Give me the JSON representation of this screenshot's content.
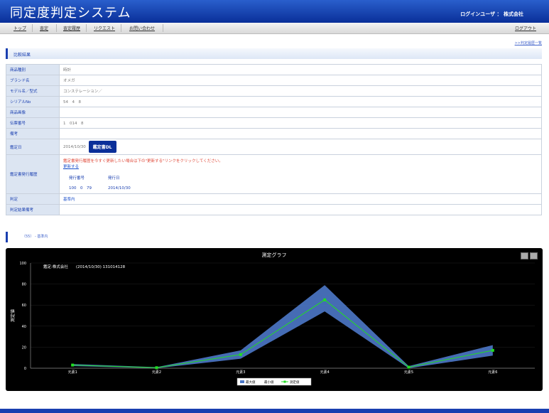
{
  "header": {
    "title": "同定度判定システム",
    "login_label": "ログインユーザ ： 株式会社"
  },
  "nav": {
    "items": [
      "トップ",
      "査定",
      "査定履歴",
      "リクエスト",
      "お問い合わせ"
    ],
    "logout": "ログアウト"
  },
  "history_link": ">>判定履歴一覧",
  "section_title": "比較結果",
  "info": {
    "rows": [
      {
        "label": "商品種別",
        "value": "時計"
      },
      {
        "label": "ブランド名",
        "value": "オメガ"
      },
      {
        "label": "モデル名／型式",
        "value": "コンステレーション／"
      },
      {
        "label": "シリアルNo",
        "value": "54　4　8"
      },
      {
        "label": "商品画像",
        "value": ""
      },
      {
        "label": "伝票番号",
        "value": "1　014　8"
      },
      {
        "label": "備考",
        "value": ""
      }
    ],
    "date_label": "鑑定日",
    "date_value": "2014/10/30",
    "dl_button": "鑑定書DL",
    "history_label": "鑑定書発行履歴",
    "history_warning": "鑑定書発行履歴を今すぐ更新したい場合は下の\"更新する\"リンクをクリックしてください。",
    "history_update": "更新する",
    "history_headers": [
      "発行番号",
      "発行日"
    ],
    "history_values": [
      "100　0　79",
      "2014/10/30"
    ],
    "judge_label": "判定",
    "judge_value": "基準内",
    "judge_note_label": "判定結果備考",
    "judge_note_value": ""
  },
  "result_line": "（55） - 基準内",
  "chart_data": {
    "type": "line",
    "title": "測定グラフ",
    "annotation": "鑑定:株式会社　　(2014/10/30) 131014128",
    "ylabel": "測定値",
    "ylim": [
      0,
      100
    ],
    "yticks": [
      0,
      20,
      40,
      60,
      80,
      100
    ],
    "categories": [
      "元素1",
      "元素2",
      "元素3",
      "元素4",
      "元素5",
      "元素6"
    ],
    "series": [
      {
        "name": "最大値",
        "values": [
          4,
          1,
          17,
          79,
          2,
          22
        ]
      },
      {
        "name": "最小値",
        "values": [
          2,
          0,
          9,
          54,
          0,
          12
        ]
      },
      {
        "name": "測定値",
        "values": [
          3,
          0.5,
          13,
          65,
          1,
          17
        ]
      }
    ],
    "legend_position": "bottom-center",
    "colors": {
      "band": "#4c78c8",
      "line": "#22dd22"
    }
  }
}
